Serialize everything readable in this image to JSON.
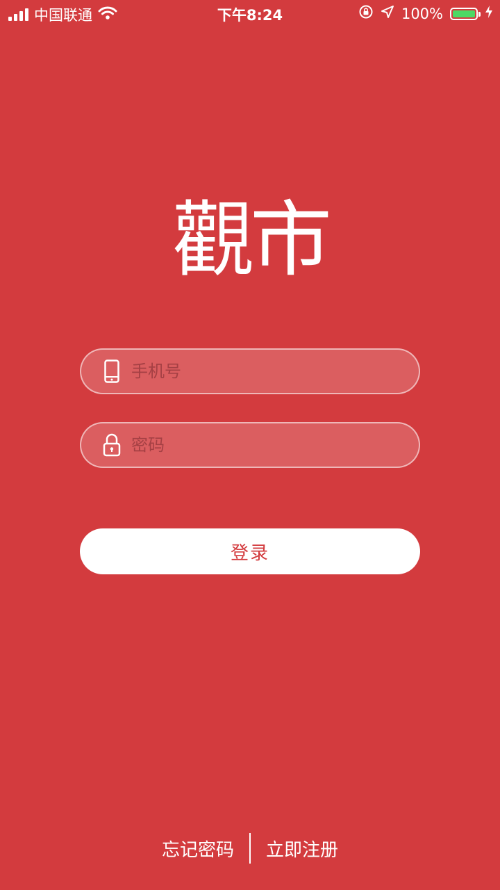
{
  "status_bar": {
    "carrier": "中国联通",
    "time": "下午8:24",
    "battery": "100%",
    "battery_color": "#4cd964"
  },
  "logo": {
    "text": "觀市"
  },
  "form": {
    "phone_placeholder": "手机号",
    "phone_value": "",
    "phone_icon": "phone-icon",
    "password_placeholder": "密码",
    "password_value": "",
    "password_icon": "lock-icon"
  },
  "login_button_label": "登录",
  "links": {
    "forgot_password": "忘记密码",
    "register": "立即注册"
  },
  "colors": {
    "background": "#d33b3e",
    "button_text": "#d33b3e",
    "button_bg": "#ffffff"
  }
}
